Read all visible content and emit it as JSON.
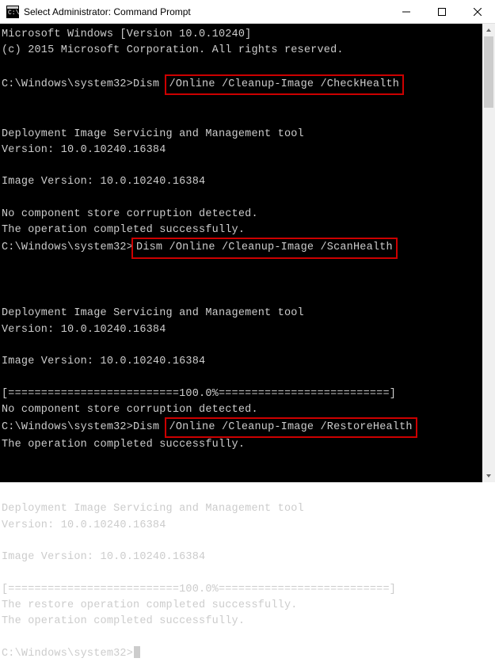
{
  "titlebar": {
    "title": "Select Administrator: Command Prompt"
  },
  "terminal": {
    "prompt": "C:\\Windows\\system32>",
    "lines": [
      "Microsoft Windows [Version 10.0.10240]",
      "(c) 2015 Microsoft Corporation. All rights reserved.",
      "",
      "",
      "",
      "Deployment Image Servicing and Management tool",
      "Version: 10.0.10240.16384",
      "",
      "Image Version: 10.0.10240.16384",
      "",
      "No component store corruption detected.",
      "The operation completed successfully.",
      "",
      "",
      "",
      "Deployment Image Servicing and Management tool",
      "Version: 10.0.10240.16384",
      "",
      "Image Version: 10.0.10240.16384",
      "",
      "[==========================100.0%==========================]",
      "No component store corruption detected.",
      "The operation completed successfully.",
      "",
      "",
      "",
      "Deployment Image Servicing and Management tool",
      "Version: 10.0.10240.16384",
      "",
      "Image Version: 10.0.10240.16384",
      "",
      "[==========================100.0%==========================]",
      "The restore operation completed successfully.",
      "The operation completed successfully.",
      ""
    ],
    "commands": [
      {
        "pre": "Dism ",
        "hl": "/Online /Cleanup-Image /CheckHealth",
        "row": 3
      },
      {
        "pre": "",
        "hl": "Dism /Online /Cleanup-Image /ScanHealth",
        "row": 13
      },
      {
        "pre": "Dism ",
        "hl": "/Online /Cleanup-Image /RestoreHealth",
        "row": 24
      }
    ]
  }
}
